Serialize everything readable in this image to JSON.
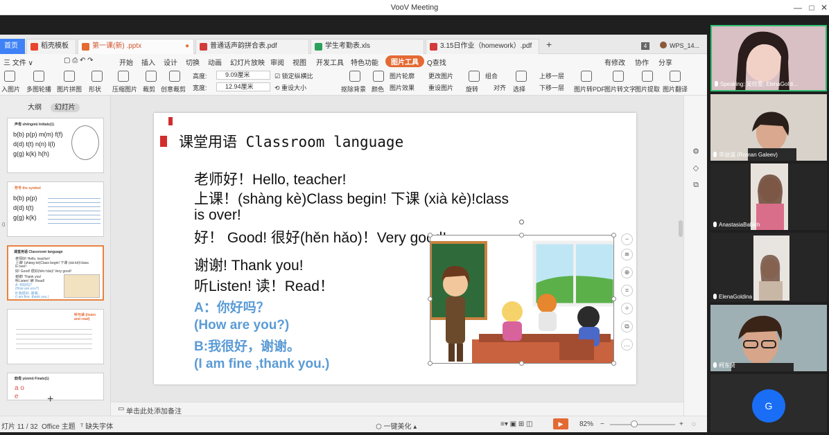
{
  "window": {
    "title": "VooV Meeting",
    "controls": [
      "—",
      "□",
      "✕"
    ]
  },
  "wps": {
    "tabs": [
      {
        "label": "首页"
      },
      {
        "label": "稻壳模板"
      },
      {
        "label": "第一课(新) .pptx"
      },
      {
        "label": "普通话声韵拼合表.pdf"
      },
      {
        "label": "学生考勤表.xls"
      },
      {
        "label": "3.15日作业（homework）.pdf"
      }
    ],
    "tab_add": "+",
    "tab_count": "4",
    "account": "WPS_14...",
    "menu": [
      "三 文件 ∨",
      "开始",
      "插入",
      "设计",
      "切换",
      "动画",
      "幻灯片放映",
      "审阅",
      "视图",
      "开发工具",
      "特色功能",
      "图片工具",
      "Q查找"
    ],
    "menu_right": [
      "有修改",
      "协作",
      "分享"
    ],
    "toolbar_left": [
      "入图片",
      "多图轮播",
      "图片拼图",
      "形状",
      "压缩图片",
      "裁剪",
      "创意裁剪"
    ],
    "height_label": "高度:",
    "height_value": "9.09厘米",
    "width_label": "宽度:",
    "width_value": "12.94厘米",
    "lock_ratio": "锁定纵横比",
    "reset_size": "重设大小",
    "toolbar_right": [
      "抠除背景",
      "颜色",
      "图片轮廓",
      "图片效果",
      "更改图片",
      "重设图片",
      "旋转",
      "组合",
      "对齐",
      "选择",
      "上移一层",
      "下移一层",
      "图片转PDF",
      "图片转文字",
      "图片提取",
      "图片翻译"
    ],
    "panel_tabs": [
      "大纲",
      "幻灯片"
    ],
    "notes_placeholder": "单击此处添加备注",
    "status": {
      "slide_info": "灯片 11 / 32",
      "theme": "Office 主题",
      "missing_font": "缺失字体",
      "beautify": "一键美化",
      "zoom": "82%"
    },
    "thumbnails": [
      {
        "num": "",
        "title": "声母 shēngmǔ  Initials(1)",
        "lines": [
          "b(b) p(p) m(m) f(f)",
          "d(d) t(t) n(n) l(l)",
          "g(g) k(k) h(h)"
        ]
      },
      {
        "num": "0",
        "title": "符号 the symbol",
        "lines": [
          "b(b) p(p)",
          "d(d) t(t)",
          "g(g) k(k)"
        ]
      },
      {
        "num": "",
        "title": "课堂用语 Classroom language",
        "lines": [
          "老师好! Hello, teacher!",
          "上课! (shàng kè)Class begin! 下课 (xià kè)!class",
          "is over!",
          "好! Good! 很好(hěn hǎo)! Very good!",
          "谢谢! Thank you!",
          "听Listen! 读! Read!",
          "A: 你好吗?",
          "(How are you?)",
          "B:我很好, 谢谢。",
          "(I am fine ,thank you.)"
        ]
      },
      {
        "num": "",
        "title": "听与读 (listen and read)",
        "lines": [
          "",
          "",
          ""
        ]
      },
      {
        "num": "",
        "title": "韵母 yùnmǔ  Finals(1)",
        "lines": [
          "a  o",
          "e"
        ]
      }
    ]
  },
  "slide": {
    "title": "课堂用语 Classroom language",
    "lines": [
      "老师好！Hello, teacher!",
      "上课！(shàng kè)Class begin!  下课 (xià kè)!class",
      "is over!",
      "好！ Good! 很好(hěn hǎo)！Very good!",
      "谢谢! Thank you!",
      "听Listen!  读！Read！"
    ],
    "blue_lines": [
      "A：你好吗？",
      "(How are you?)",
      "B:我很好，谢谢。",
      "(I am fine ,thank you.)"
    ]
  },
  "participants": [
    {
      "name": "Speaking: 吴欣雯; ElenaGoldi..."
    },
    {
      "name": "华益诚 (Roman Galeev)"
    },
    {
      "name": "AnastasiaBabich"
    },
    {
      "name": "ElenaGoldina"
    },
    {
      "name": "柯东贤"
    },
    {
      "name": "",
      "avatar": "G"
    }
  ],
  "colors": {
    "accent": "#e46a33",
    "home_tab": "#3f82f7",
    "slide_blue": "#5b9bd5",
    "avatar": "#1a6ef5"
  }
}
